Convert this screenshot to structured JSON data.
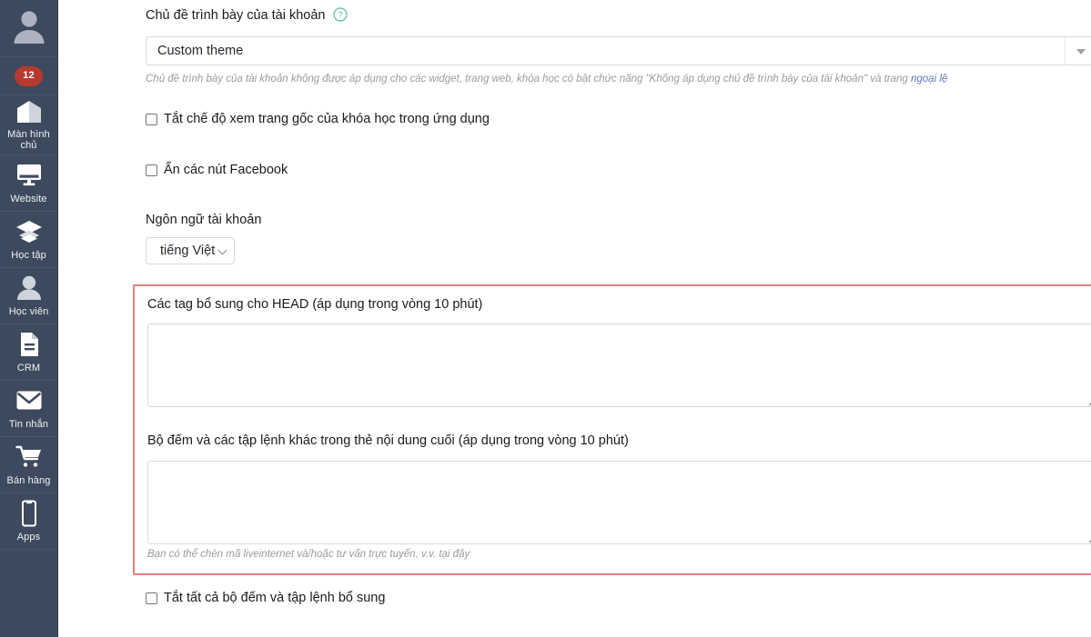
{
  "sidebar": {
    "avatar": {
      "name": "user-avatar",
      "icon": "person-icon"
    },
    "badge": {
      "count": "12"
    },
    "items": [
      {
        "label": "Màn hình chủ",
        "icon": "home-icon",
        "name": "sidebar-item-home"
      },
      {
        "label": "Website",
        "icon": "monitor-icon",
        "name": "sidebar-item-website"
      },
      {
        "label": "Học tập",
        "icon": "layers-icon",
        "name": "sidebar-item-learning"
      },
      {
        "label": "Học viên",
        "icon": "student-icon",
        "name": "sidebar-item-students"
      },
      {
        "label": "CRM",
        "icon": "document-icon",
        "name": "sidebar-item-crm"
      },
      {
        "label": "Tin nhắn",
        "icon": "envelope-icon",
        "name": "sidebar-item-messages"
      },
      {
        "label": "Bán hàng",
        "icon": "cart-icon",
        "name": "sidebar-item-sales"
      },
      {
        "label": "Apps",
        "icon": "mobile-icon",
        "name": "sidebar-item-apps"
      }
    ]
  },
  "theme": {
    "label": "Chủ đề trình bày của tài khoản",
    "help_icon": "question-circle-icon",
    "selected": "Custom theme",
    "hint_before": "Chủ đề trình bày của tài khoản không được áp dụng cho các widget, trang web, khóa học có bật chức năng \"Không áp dụng chủ đề trình bày của tài khoản\" và trang ",
    "hint_link": "ngoại lệ"
  },
  "checkboxes": {
    "disable_native_view": {
      "label": "Tắt chế độ xem trang gốc của khóa học trong ứng dụng",
      "checked": false
    },
    "hide_facebook": {
      "label": "Ẩn các nút Facebook",
      "checked": false
    },
    "disable_all_counters": {
      "label": "Tắt tất cả bộ đếm và tập lệnh bổ sung",
      "checked": false
    }
  },
  "language": {
    "label": "Ngôn ngữ tài khoản",
    "selected": "tiếng Việt",
    "chevron_icon": "chevron-down-icon"
  },
  "head_tags": {
    "label": "Các tag bổ sung cho HEAD (áp dụng trong vòng 10 phút)",
    "value": "",
    "placeholder": ""
  },
  "body_tags": {
    "label": "Bộ đếm và các tập lệnh khác trong thẻ nội dung cuối (áp dụng trong vòng 10 phút)",
    "value": "",
    "placeholder": "",
    "hint": "Bạn có thể chèn mã liveinternet và/hoặc tư vấn trực tuyến, v.v. tại đây"
  },
  "colors": {
    "sidebar_bg": "#3d4a5d",
    "badge_bg": "#b7392f",
    "highlight_border": "#e08080",
    "link": "#5b7ab5",
    "help_icon": "#57bda0"
  }
}
